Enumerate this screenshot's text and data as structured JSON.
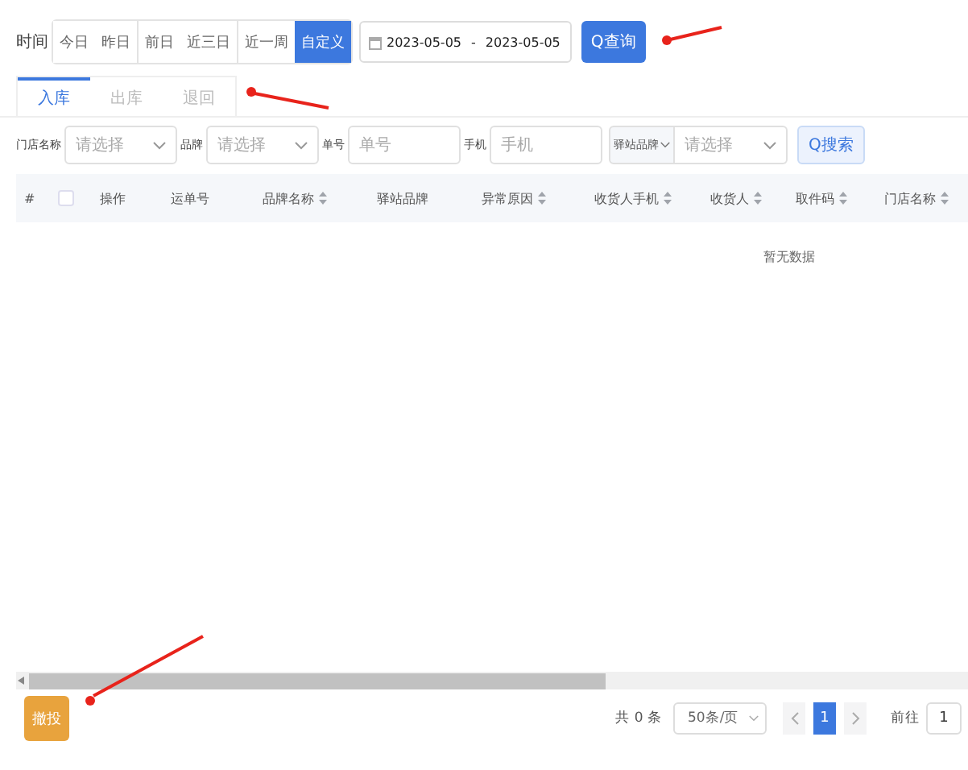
{
  "time_filter": {
    "label": "时间",
    "options": [
      {
        "label": "今日",
        "selected": false
      },
      {
        "label": "昨日",
        "selected": false
      },
      {
        "label": "前日",
        "selected": false
      },
      {
        "label": "近三日",
        "selected": false
      },
      {
        "label": "近一周",
        "selected": false
      },
      {
        "label": "自定义",
        "selected": true
      }
    ],
    "date_start": "2023-05-05",
    "date_separator": "-",
    "date_end": "2023-05-05",
    "query_button": "Q查询"
  },
  "tabs": [
    {
      "label": "入库",
      "selected": true
    },
    {
      "label": "出库",
      "selected": false
    },
    {
      "label": "退回",
      "selected": false
    }
  ],
  "filters": [
    {
      "kind": "select",
      "label": "门店名称",
      "placeholder": "请选择"
    },
    {
      "kind": "select",
      "label": "品牌",
      "placeholder": "请选择"
    },
    {
      "kind": "input",
      "label": "单号",
      "placeholder": "单号"
    },
    {
      "kind": "input",
      "label": "手机",
      "placeholder": "手机"
    },
    {
      "kind": "combo",
      "label": "驿站品牌",
      "placeholder": "请选择"
    }
  ],
  "search_button": "Q搜索",
  "table": {
    "columns": [
      {
        "kind": "index",
        "label": "#",
        "sortable": false
      },
      {
        "kind": "checkbox",
        "sortable": false,
        "checked": false
      },
      {
        "kind": "text",
        "label": "操作",
        "sortable": false
      },
      {
        "kind": "text",
        "label": "运单号",
        "sortable": false
      },
      {
        "kind": "text",
        "label": "品牌名称",
        "sortable": true
      },
      {
        "kind": "text",
        "label": "驿站品牌",
        "sortable": false
      },
      {
        "kind": "text",
        "label": "异常原因",
        "sortable": true
      },
      {
        "kind": "text",
        "label": "收货人手机",
        "sortable": true
      },
      {
        "kind": "text",
        "label": "收货人",
        "sortable": true
      },
      {
        "kind": "text",
        "label": "取件码",
        "sortable": true
      },
      {
        "kind": "text",
        "label": "门店名称",
        "sortable": true
      }
    ],
    "empty_text": "暂无数据"
  },
  "footer": {
    "action_button": "撤投",
    "total": "共 0 条",
    "page_size": "50条/页",
    "pages": [
      {
        "label": "1",
        "selected": true
      }
    ],
    "goto_label": "前往",
    "goto_value": "1"
  },
  "annotations": [
    {
      "kind": "arrow"
    },
    {
      "kind": "arrow"
    },
    {
      "kind": "arrow"
    }
  ]
}
